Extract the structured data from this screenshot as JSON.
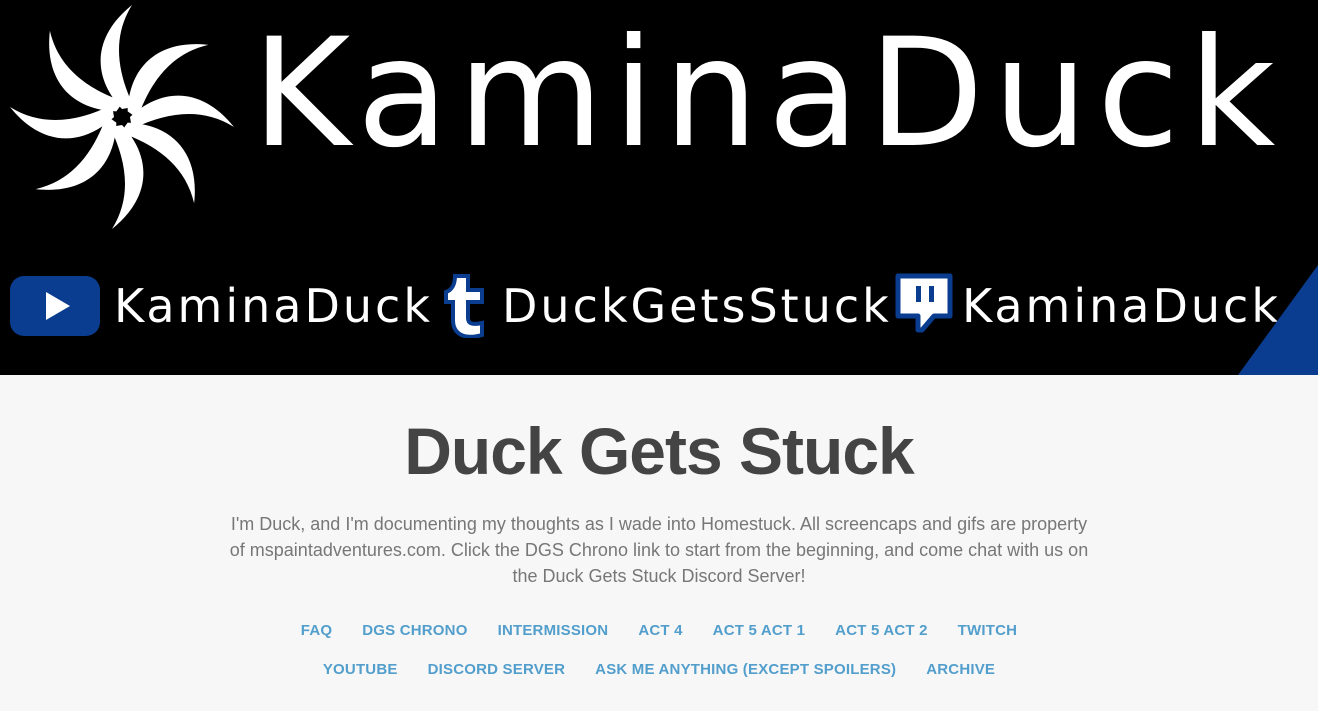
{
  "banner": {
    "title": "KaminaDuck",
    "social": [
      {
        "icon": "youtube-icon",
        "label": "KaminaDuck"
      },
      {
        "icon": "tumblr-icon",
        "label": "DuckGetsStuck"
      },
      {
        "icon": "twitch-icon",
        "label": "KaminaDuck"
      }
    ],
    "accent_color": "#0a3d8f"
  },
  "blog": {
    "title": "Duck Gets Stuck",
    "description": "I'm Duck, and I'm documenting my thoughts as I wade into Homestuck. All screencaps and gifs are property of mspaintadventures.com. Click the DGS Chrono link to start from the beginning, and come chat with us on the Duck Gets Stuck Discord Server!"
  },
  "nav": {
    "row1": [
      "FAQ",
      "DGS CHRONO",
      "INTERMISSION",
      "ACT 4",
      "ACT 5 ACT 1",
      "ACT 5 ACT 2",
      "TWITCH"
    ],
    "row2": [
      "YOUTUBE",
      "DISCORD SERVER",
      "ASK ME ANYTHING (EXCEPT SPOILERS)",
      "ARCHIVE"
    ],
    "link_color": "#529ecc"
  }
}
